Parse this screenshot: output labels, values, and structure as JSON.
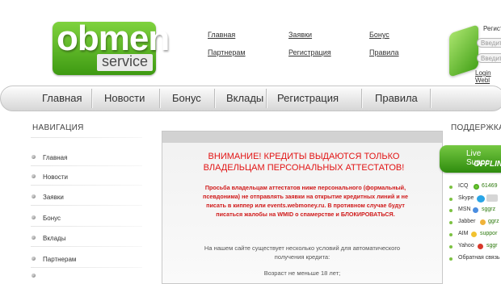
{
  "logo": {
    "main": "obmen",
    "sub": "service"
  },
  "top_links": {
    "col1": [
      "Главная",
      "Партнерам"
    ],
    "col2": [
      "Заявки",
      "Регистрация"
    ],
    "col3": [
      "Бонус",
      "Правила"
    ]
  },
  "login": {
    "label": "Регист",
    "input1_placeholder": "Введите",
    "input2_placeholder": "Введите",
    "link": "Login Webl"
  },
  "menu": [
    "Главная",
    "Новости",
    "Бонус",
    "Вклады",
    "Регистрация",
    "Правила"
  ],
  "nav": {
    "title": "НАВИГАЦИЯ",
    "items": [
      "Главная",
      "Новости",
      "Заявки",
      "Бонус",
      "Вклады",
      "Партнерам",
      ""
    ]
  },
  "notice": {
    "title_line1": "ВНИМАНИЕ! КРЕДИТЫ ВЫДАЮТСЯ ТОЛЬКО",
    "title_line2": "ВЛАДЕЛЬЦАМ ПЕРСОНАЛЬНЫХ АТТЕСТАТОВ!",
    "body_lines": [
      "Просьба владельцам аттестатов ниже персонального (формальный,",
      "псевдонима) не отправлять заявки на открытие кредитных линий и не",
      "писать в киппер или events.webmoney.ru. В противном случае будут",
      "писаться жалобы на WMID о спамерстве и БЛОКИРОВАТЬСЯ."
    ],
    "conditions_line1": "На нашем сайте существует несколько условий для автоматического",
    "conditions_line2": "получения кредита:",
    "age": "Возраст не меньше 18 лет;"
  },
  "support": {
    "title": "ПОДДЕРЖКА",
    "live_label": "Live Suppo",
    "live_status": "OFFLIN",
    "contacts": [
      {
        "label": "ICQ",
        "value": "61469",
        "icon": "icq-flower-icon"
      },
      {
        "label": "Skype",
        "value": "",
        "icon": "skype-icon"
      },
      {
        "label": "MSN",
        "value": "sggrz",
        "icon": "msn-icon"
      },
      {
        "label": "Jabber",
        "value": "ggrz",
        "icon": "jabber-icon"
      },
      {
        "label": "AIM",
        "value": "suppor",
        "icon": "aim-icon"
      },
      {
        "label": "Yahoo",
        "value": "sggr",
        "icon": "yahoo-icon"
      },
      {
        "label": "Обратная связь",
        "value": "",
        "icon": ""
      }
    ]
  },
  "colors": {
    "brand_green": "#4caf1e",
    "warning_red": "#e21414"
  }
}
